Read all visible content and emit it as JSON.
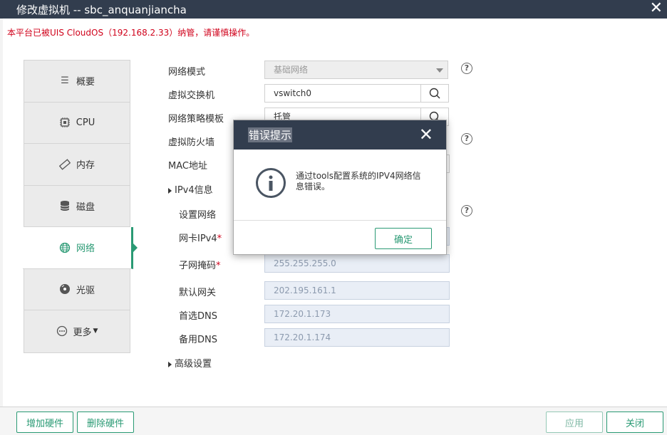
{
  "window": {
    "title": "修改虚拟机 -- sbc_anquanjiancha"
  },
  "warning": "本平台已被UIS CloudOS（192.168.2.33）纳管，请谨慎操作。",
  "nav": [
    {
      "label": "概要",
      "icon": "list-icon"
    },
    {
      "label": "CPU",
      "icon": "cpu-icon"
    },
    {
      "label": "内存",
      "icon": "memory-icon"
    },
    {
      "label": "磁盘",
      "icon": "disk-icon"
    },
    {
      "label": "网络",
      "icon": "globe-icon",
      "active": true
    },
    {
      "label": "光驱",
      "icon": "cdrom-icon"
    },
    {
      "label": "更多",
      "icon": "more-icon"
    }
  ],
  "form": {
    "network_mode": {
      "label": "网络模式",
      "value": "基础网络"
    },
    "vswitch": {
      "label": "虚拟交换机",
      "value": "vswitch0"
    },
    "policy_template": {
      "label": "网络策略模板",
      "value": "托管"
    },
    "firewall": {
      "label": "虚拟防火墙"
    },
    "mac": {
      "label": "MAC地址"
    },
    "ipv4_section": {
      "label": "IPv4信息"
    },
    "set_network": {
      "label": "设置网络"
    },
    "nic_ipv4": {
      "label": "网卡IPv4"
    },
    "subnet_mask": {
      "label": "子网掩码",
      "value": "255.255.255.0"
    },
    "gateway": {
      "label": "默认网关",
      "value": "202.195.161.1"
    },
    "dns_primary": {
      "label": "首选DNS",
      "value": "172.20.1.173"
    },
    "dns_secondary": {
      "label": "备用DNS",
      "value": "172.20.1.174"
    },
    "advanced": {
      "label": "高级设置"
    },
    "required_mark": "*",
    "help_mark": "?"
  },
  "footer": {
    "add_hw": "增加硬件",
    "remove_hw": "删除硬件",
    "apply": "应用",
    "close": "关闭"
  },
  "dialog": {
    "title": "错误提示",
    "message": "通过tools配置系统的IPV4网络信息错误。",
    "ok": "确定"
  }
}
